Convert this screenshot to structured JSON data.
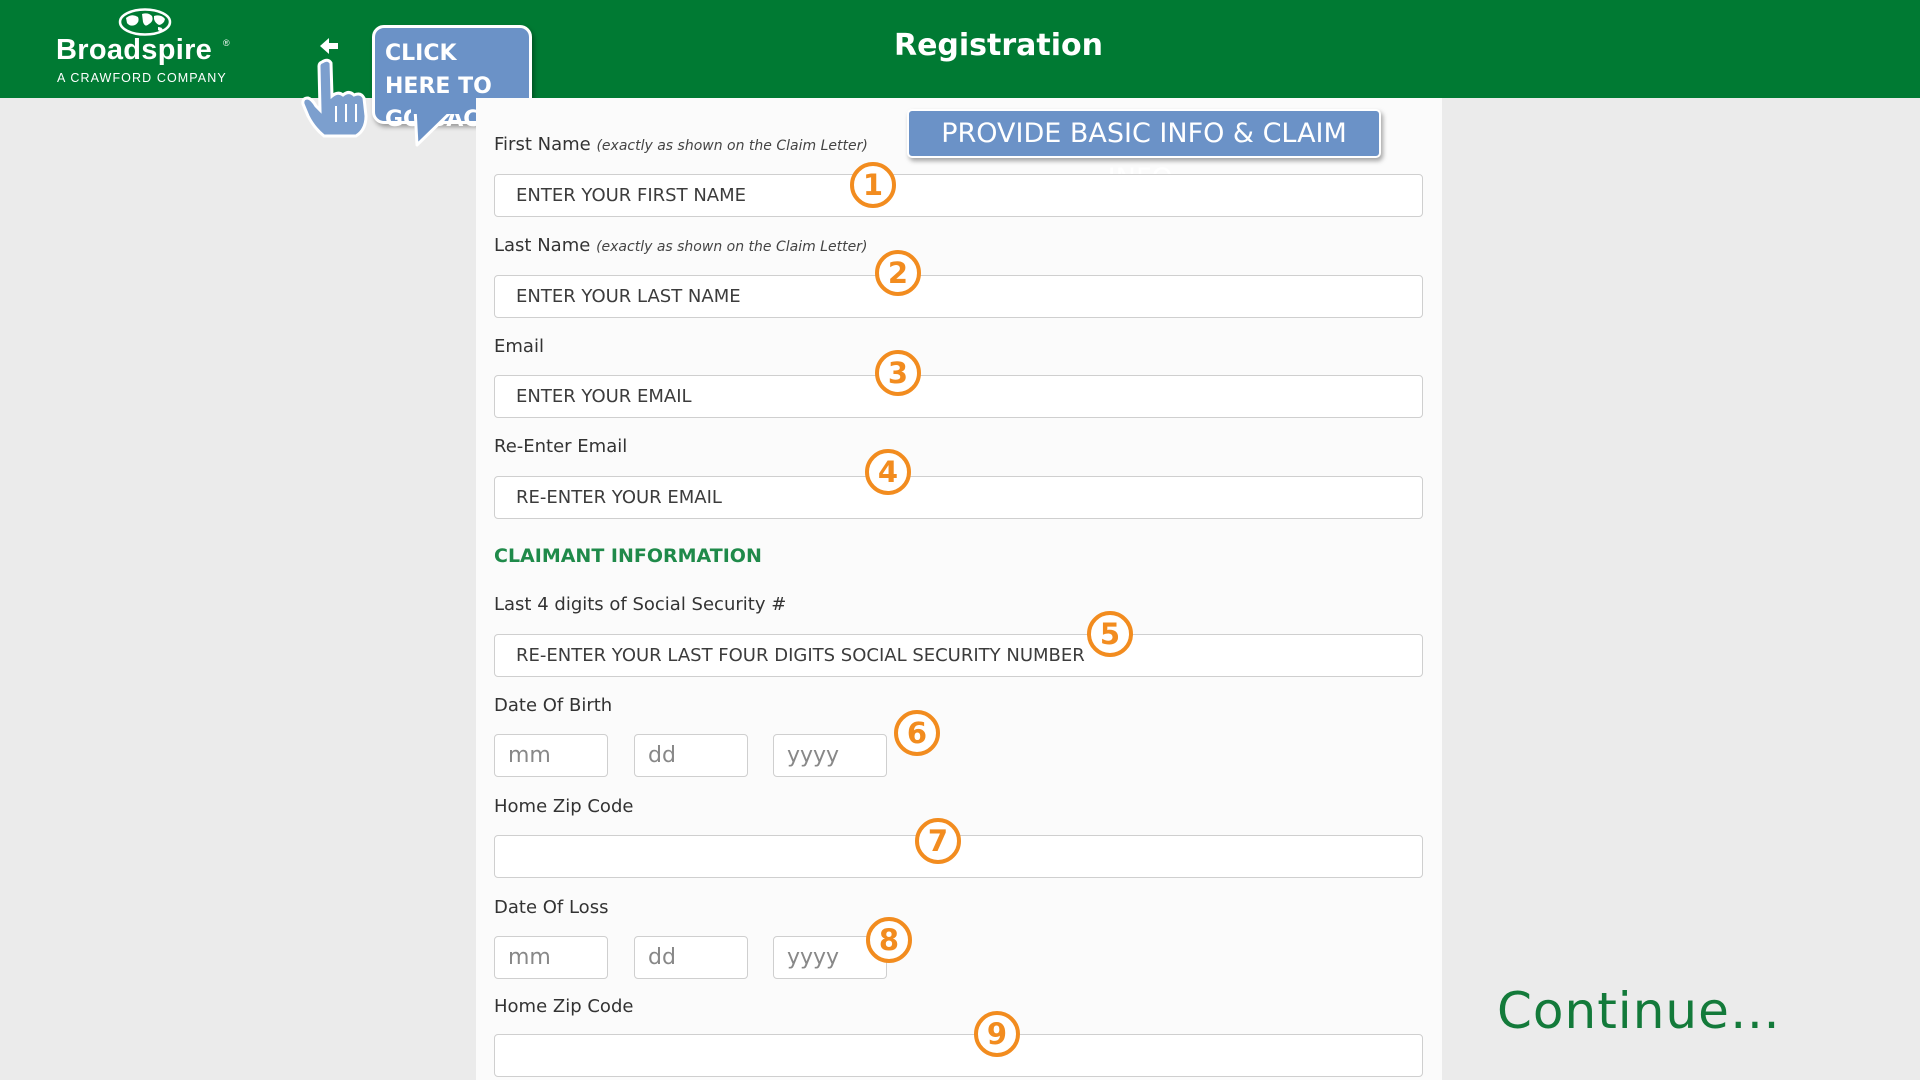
{
  "header": {
    "logo_name": "Broadspire",
    "logo_registered": "®",
    "logo_tagline": "A CRAWFORD COMPANY",
    "title": "Registration",
    "back_callout_line1": "CLICK HERE TO",
    "back_callout_line2": "GO BACK"
  },
  "info_callout": "PROVIDE BASIC INFO & CLAIM INFO.",
  "form": {
    "first_name": {
      "label": "First Name",
      "note": "(exactly as shown on the Claim Letter)",
      "placeholder": "ENTER YOUR FIRST NAME"
    },
    "last_name": {
      "label": "Last Name",
      "note": "(exactly as shown on the Claim Letter)",
      "placeholder": "ENTER YOUR LAST NAME"
    },
    "email": {
      "label": "Email",
      "placeholder": "ENTER YOUR EMAIL"
    },
    "reenter_email": {
      "label": "Re-Enter Email",
      "placeholder": "RE-ENTER YOUR EMAIL"
    },
    "section_claimant": "CLAIMANT INFORMATION",
    "ssn": {
      "label": "Last 4 digits of Social Security #",
      "placeholder": "RE-ENTER YOUR LAST FOUR DIGITS SOCIAL SECURITY NUMBER"
    },
    "dob": {
      "label": "Date Of Birth",
      "mm": "mm",
      "dd": "dd",
      "yyyy": "yyyy"
    },
    "home_zip_1": {
      "label": "Home Zip Code",
      "placeholder": ""
    },
    "date_of_loss": {
      "label": "Date Of Loss",
      "mm": "mm",
      "dd": "dd",
      "yyyy": "yyyy"
    },
    "home_zip_2": {
      "label": "Home Zip Code",
      "placeholder": ""
    }
  },
  "step_badges": [
    "1",
    "2",
    "3",
    "4",
    "5",
    "6",
    "7",
    "8",
    "9"
  ],
  "continue_text": "Continue…",
  "colors": {
    "brand_green": "#007a33",
    "section_green": "#1f8a4a",
    "callout_blue": "#6b92c7",
    "badge_orange": "#f28c1f",
    "continue_green": "#137a3a"
  },
  "icons": [
    "globe-icon",
    "back-arrow-icon",
    "pointing-hand-icon"
  ]
}
